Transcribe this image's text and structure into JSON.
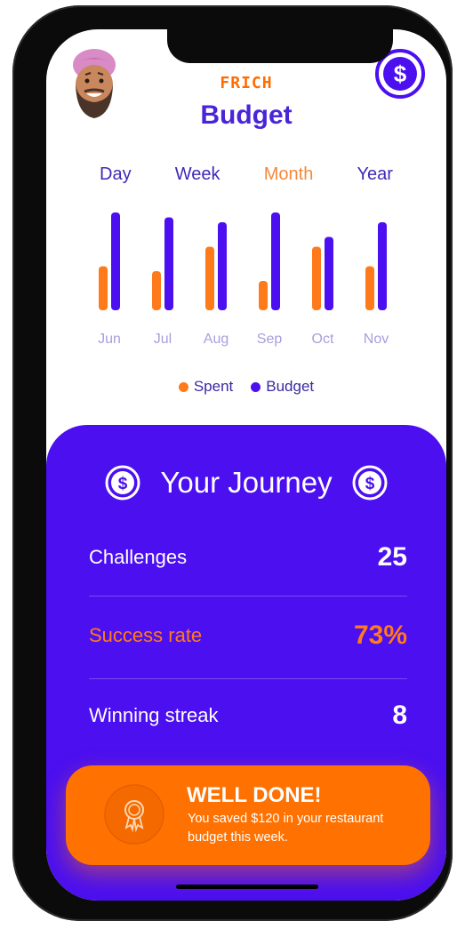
{
  "header": {
    "brand": "FRICH",
    "title": "Budget",
    "avatar_icon": "avatar-icon",
    "currency_icon": "dollar-icon"
  },
  "tabs": [
    {
      "label": "Day",
      "active": false
    },
    {
      "label": "Week",
      "active": false
    },
    {
      "label": "Month",
      "active": true
    },
    {
      "label": "Year",
      "active": false
    }
  ],
  "chart_data": {
    "type": "bar",
    "categories": [
      "Jun",
      "Jul",
      "Aug",
      "Sep",
      "Oct",
      "Nov"
    ],
    "series": [
      {
        "name": "Spent",
        "values": [
          45,
          40,
          65,
          30,
          65,
          45
        ],
        "color": "#ff7a1a"
      },
      {
        "name": "Budget",
        "values": [
          100,
          95,
          90,
          100,
          75,
          90
        ],
        "color": "#4b0ff0"
      }
    ],
    "ylim": [
      0,
      100
    ],
    "grid": false,
    "legend": "bottom"
  },
  "legend": {
    "spent": "Spent",
    "budget": "Budget",
    "spent_color": "#ff7a1a",
    "budget_color": "#4b0ff0"
  },
  "journey": {
    "title": "Your Journey",
    "stats": [
      {
        "label": "Challenges",
        "value": "25"
      },
      {
        "label": "Success rate",
        "value": "73%"
      },
      {
        "label": "Winning streak",
        "value": "8"
      }
    ]
  },
  "notification": {
    "title": "WELL DONE!",
    "message": "You saved $120 in your restaurant budget this week.",
    "icon": "medal-icon"
  },
  "colors": {
    "primary": "#4b0ff0",
    "accent": "#ff7100",
    "title": "#4a24d8"
  }
}
